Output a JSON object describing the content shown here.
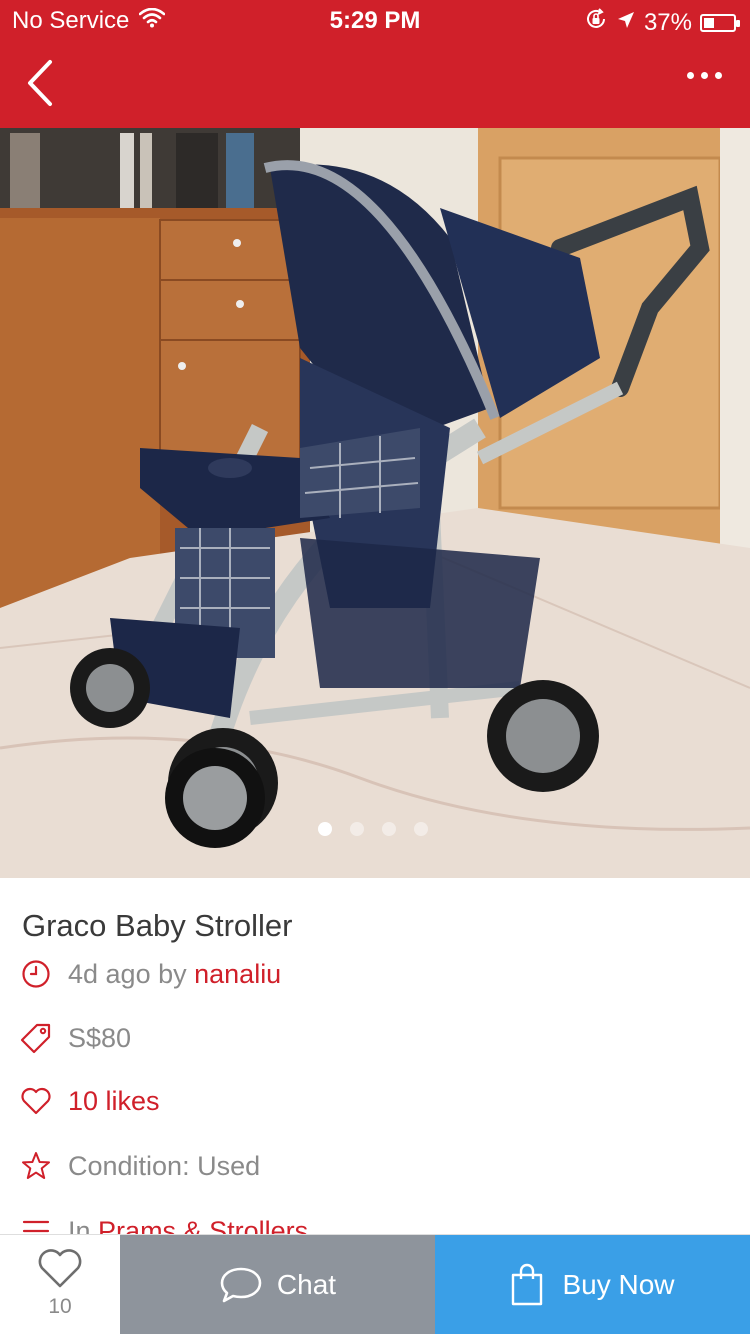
{
  "status_bar": {
    "carrier": "No Service",
    "time": "5:29 PM",
    "battery": "37%"
  },
  "nav": {
    "back_icon": "chevron-left-icon",
    "more_icon": "more-horizontal-icon"
  },
  "gallery": {
    "image_description": "stroller photo",
    "page_count": 4,
    "current_page": 1
  },
  "listing": {
    "title": "Graco Baby Stroller",
    "posted_ago": "4d ago by",
    "seller": "nanaliu",
    "price": "S$80",
    "likes": "10 likes",
    "condition": "Condition: Used",
    "category_prefix": "In",
    "category": "Prams & Strollers"
  },
  "bottom_bar": {
    "like_count": "10",
    "chat_label": "Chat",
    "buy_label": "Buy Now"
  },
  "colors": {
    "brand_red": "#d0202a",
    "chat_gray": "#8e949c",
    "buy_blue": "#3a9fe7"
  }
}
